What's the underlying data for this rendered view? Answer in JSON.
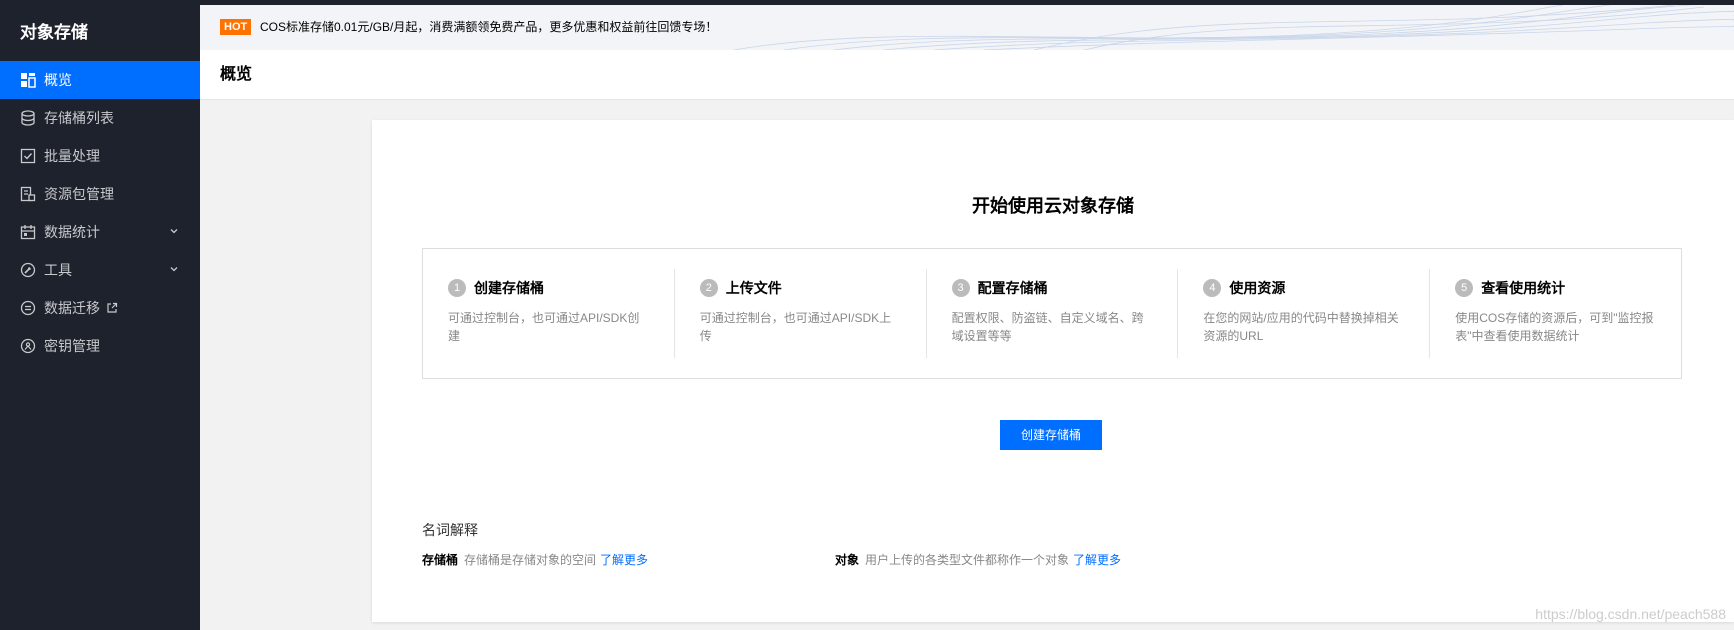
{
  "sidebar": {
    "brand": "对象存储",
    "items": [
      {
        "label": "概览",
        "icon": "grid-icon"
      },
      {
        "label": "存储桶列表",
        "icon": "database-icon"
      },
      {
        "label": "批量处理",
        "icon": "checkbox-icon"
      },
      {
        "label": "资源包管理",
        "icon": "package-icon"
      },
      {
        "label": "数据统计",
        "icon": "calendar-icon"
      },
      {
        "label": "工具",
        "icon": "tools-icon"
      },
      {
        "label": "数据迁移",
        "icon": "migrate-icon"
      },
      {
        "label": "密钥管理",
        "icon": "key-icon"
      }
    ]
  },
  "banner": {
    "badge": "HOT",
    "text": "COS标准存储0.01元/GB/月起，消费满额领免费产品，更多优惠和权益前往回馈专场！"
  },
  "header": {
    "title": "概览"
  },
  "main": {
    "heading": "开始使用云对象存储",
    "steps": [
      {
        "num": "1",
        "title": "创建存储桶",
        "desc": "可通过控制台，也可通过API/SDK创建"
      },
      {
        "num": "2",
        "title": "上传文件",
        "desc": "可通过控制台，也可通过API/SDK上传"
      },
      {
        "num": "3",
        "title": "配置存储桶",
        "desc": "配置权限、防盗链、自定义域名、跨域设置等等"
      },
      {
        "num": "4",
        "title": "使用资源",
        "desc": "在您的网站/应用的代码中替换掉相关资源的URL"
      },
      {
        "num": "5",
        "title": "查看使用统计",
        "desc": "使用COS存储的资源后，可到\"监控报表\"中查看使用数据统计"
      }
    ],
    "create_button": "创建存储桶",
    "glossary": {
      "title": "名词解释",
      "items": [
        {
          "term": "存储桶",
          "definition": "存储桶是存储对象的空间",
          "link": "了解更多"
        },
        {
          "term": "对象",
          "definition": "用户上传的各类型文件都称作一个对象",
          "link": "了解更多"
        }
      ]
    }
  },
  "watermark": "https://blog.csdn.net/peach588",
  "colors": {
    "sidebar_bg": "#1e222d",
    "accent": "#006eff",
    "hot_badge": "#ff7200"
  }
}
